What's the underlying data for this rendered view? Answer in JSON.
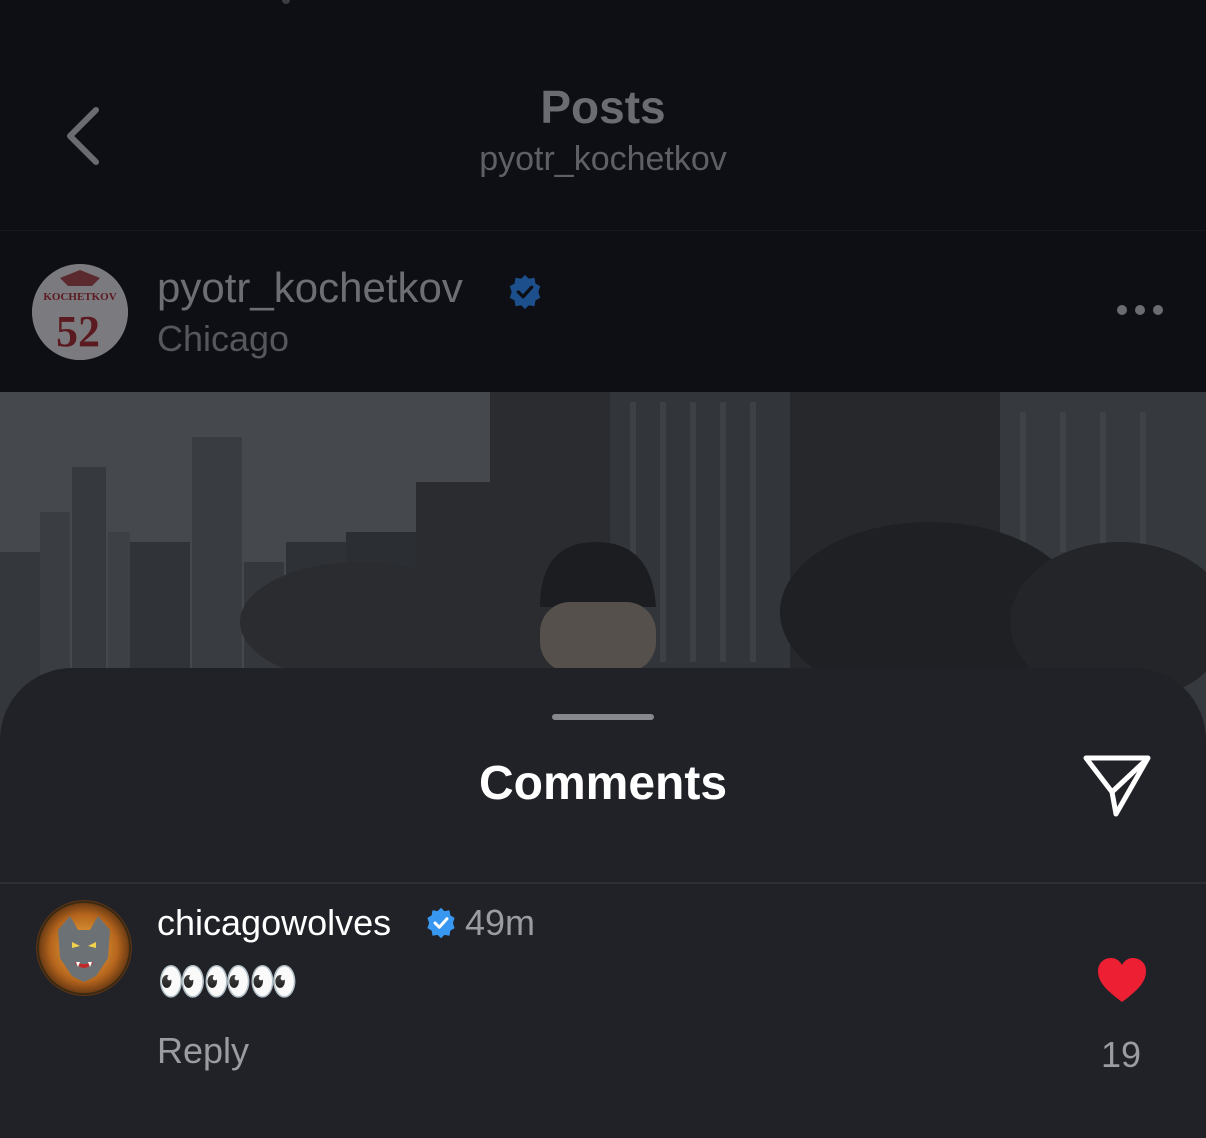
{
  "header": {
    "title": "Posts",
    "subtitle": "pyotr_kochetkov"
  },
  "post": {
    "author": "pyotr_kochetkov",
    "location": "Chicago",
    "avatar_text_top": "KOCHETKOV",
    "avatar_text_number": "52"
  },
  "comments_sheet": {
    "title": "Comments",
    "comment": {
      "username": "chicagowolves",
      "time": "49m",
      "text": "👀👀👀",
      "reply_label": "Reply",
      "likes": "19"
    }
  },
  "colors": {
    "verified": "#3897f0",
    "heart": "#ed1f33",
    "sheet_bg": "#202228",
    "dim_bg": "#0d0f14"
  },
  "icons": [
    "back-chevron-icon",
    "verified-badge-icon",
    "more-options-icon",
    "send-icon",
    "heart-icon"
  ]
}
